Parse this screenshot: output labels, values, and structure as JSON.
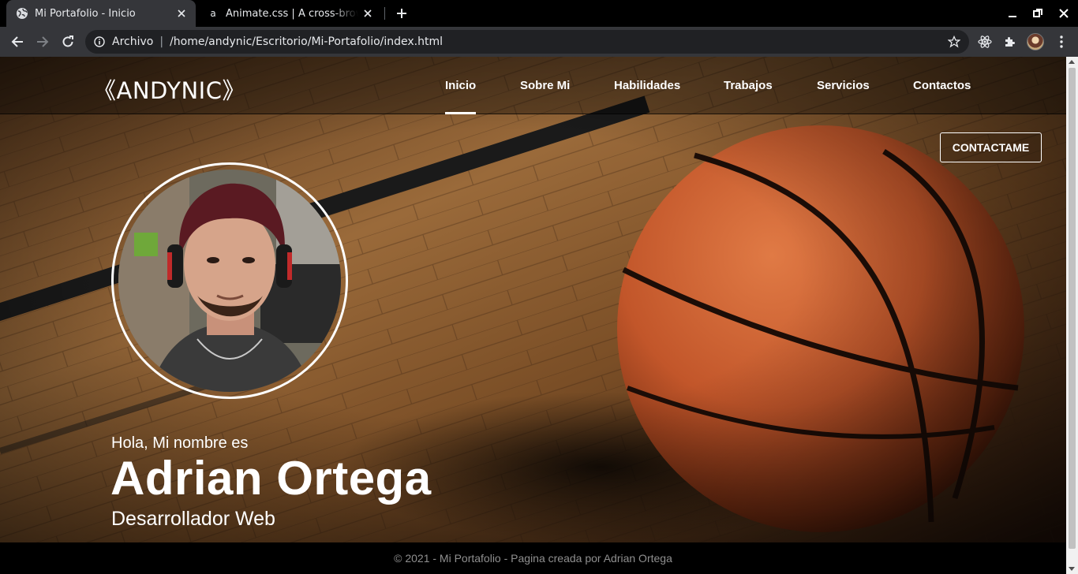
{
  "browser": {
    "tabs": [
      {
        "title": "Mi Portafolio - Inicio",
        "active": true,
        "favicon": "globe-icon"
      },
      {
        "title": "Animate.css | A cross-browser library of CSS animations",
        "active": false,
        "favicon": "a"
      }
    ],
    "address": {
      "scheme_label": "Archivo",
      "url": "/home/andynic/Escritorio/Mi-Portafolio/index.html"
    }
  },
  "site": {
    "brand": "《ANDYNIC》",
    "nav": [
      "Inicio",
      "Sobre Mi",
      "Habilidades",
      "Trabajos",
      "Servicios",
      "Contactos"
    ],
    "active_nav": "Inicio",
    "cta_label": "CONTACTAME"
  },
  "hero": {
    "greeting": "Hola, Mi nombre es",
    "name": "Adrian Ortega",
    "role": "Desarrollador Web"
  },
  "footer": {
    "text": "© 2021 - Mi Portafolio - Pagina creada por Adrian Ortega"
  },
  "colors": {
    "chrome_dark": "#000000",
    "chrome_toolbar": "#35363a",
    "omnibox": "#202124",
    "basketball": "#c2562a",
    "floor": "#8a5a2e"
  }
}
